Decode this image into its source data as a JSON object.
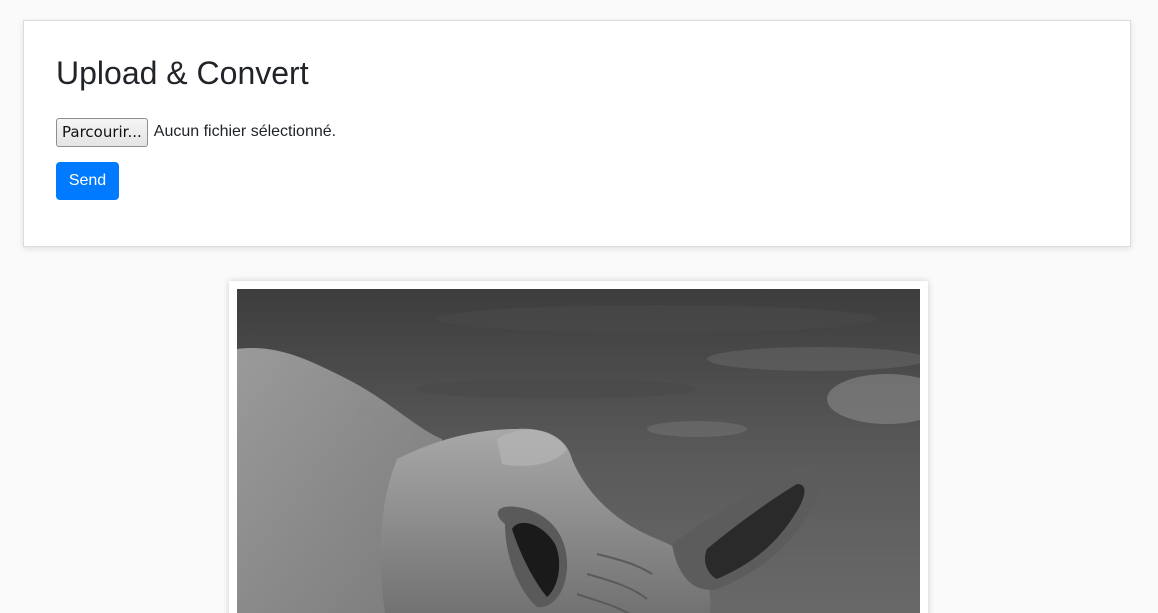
{
  "upload_card": {
    "title": "Upload & Convert",
    "file_input": {
      "browse_label": "Parcourir...",
      "status_text": "Aucun fichier sélectionné."
    },
    "send_label": "Send"
  },
  "result_image": {
    "subject": "grayscale photo of a rhinoceros",
    "colors": {
      "accent": "#007bff"
    }
  }
}
